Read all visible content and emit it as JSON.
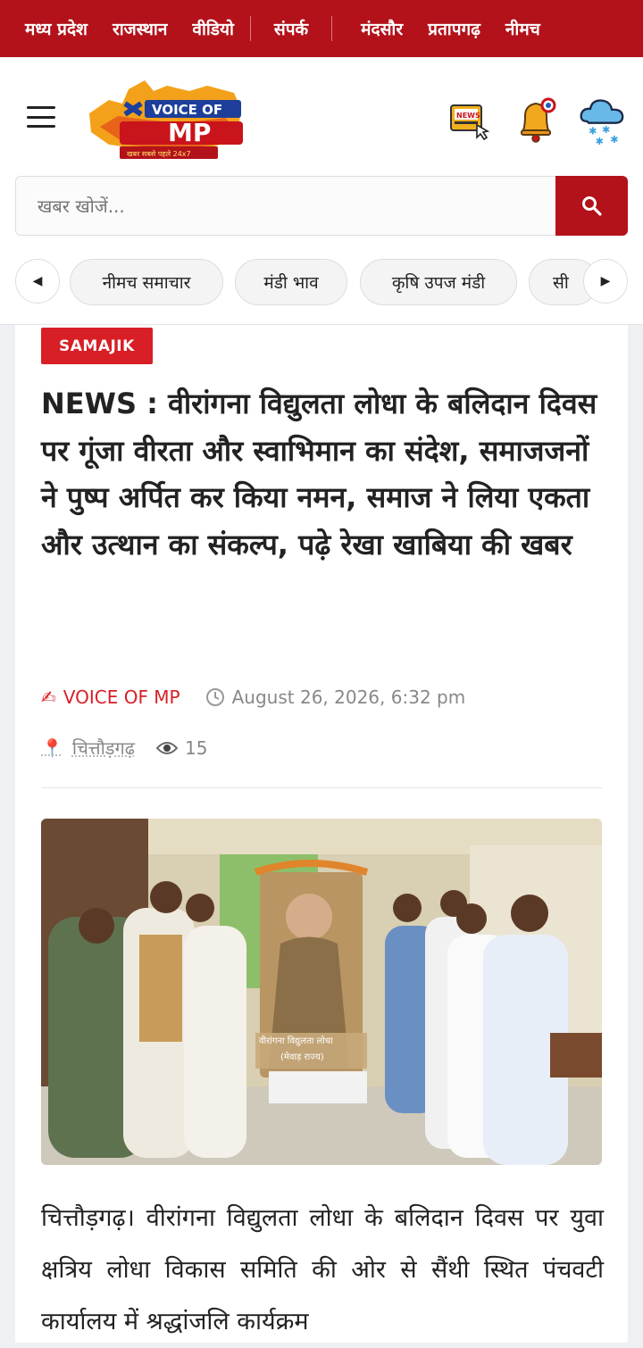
{
  "topnav": [
    "मध्य प्रदेश",
    "राजस्थान",
    "वीडियो",
    "संपर्क",
    "मंदसौर",
    "प्रतापगढ़",
    "नीमच"
  ],
  "logo": {
    "line1": "VOICE OF",
    "line2": "MP",
    "tagline": "खबर सबसे पहले 24x7"
  },
  "header_icons": [
    "news-icon",
    "bell-icon",
    "weather-icon"
  ],
  "search": {
    "placeholder": "खबर खोजें..."
  },
  "tags": [
    "नीमच समाचार",
    "मंडी भाव",
    "कृषि उपज मंडी",
    "सी"
  ],
  "article": {
    "category": "SAMAJIK",
    "title": "NEWS : वीरांगना विद्युलता लोधा के बलिदान दिवस पर गूंजा वीरता और स्वाभिमान का संदेश, समाजजनों ने पुष्प अर्पित कर किया नमन, समाज ने लिया एकता और उत्थान का संकल्प, पढ़े रेखा खाबिया की खबर",
    "author": "VOICE OF MP",
    "date": "August 26, 2026, 6:32 pm",
    "location": "चित्तौड़गढ़",
    "views": "15",
    "photo_caption_line1": "वीरांगना विद्युलता लोधा",
    "photo_caption_line2": "(मेवाड़ राज्य)",
    "body": "चित्तौड़गढ़। वीरांगना विद्युलता लोधा के बलिदान दिवस पर युवा क्षत्रिय लोधा विकास समिति की ओर से सैंथी स्थित पंचवटी कार्यालय में श्रद्धांजलि कार्यक्रम"
  },
  "colors": {
    "brand_red": "#b3121b",
    "badge_red": "#d81f26",
    "meta_gray": "#888888"
  }
}
